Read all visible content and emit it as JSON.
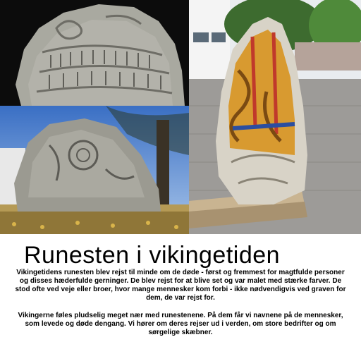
{
  "document": {
    "title": "Runesten i vikingetiden",
    "paragraphs": [
      "Vikingetidens runesten blev rejst til minde om de døde - først og fremmest for magtfulde personer og disses hæderfulde gerninger. De blev rejst for at blive set og var malet med stærke farver. De stod ofte ved veje eller broer, hvor mange mennesker kom forbi - ikke nødvendigvis ved graven for dem, de var rejst for.",
      "Vikingerne føles pludselig meget nær med runestenene. På dem får vi navnene på de mennesker, som levede og døde dengang. Vi hører om deres rejser ud i verden, om store bedrifter og om sørgelige skæbner."
    ]
  },
  "images": [
    {
      "subject": "runestone-closeup-icon"
    },
    {
      "subject": "runestone-outdoor-icon"
    },
    {
      "subject": "painted-runestone-replica-icon"
    }
  ]
}
